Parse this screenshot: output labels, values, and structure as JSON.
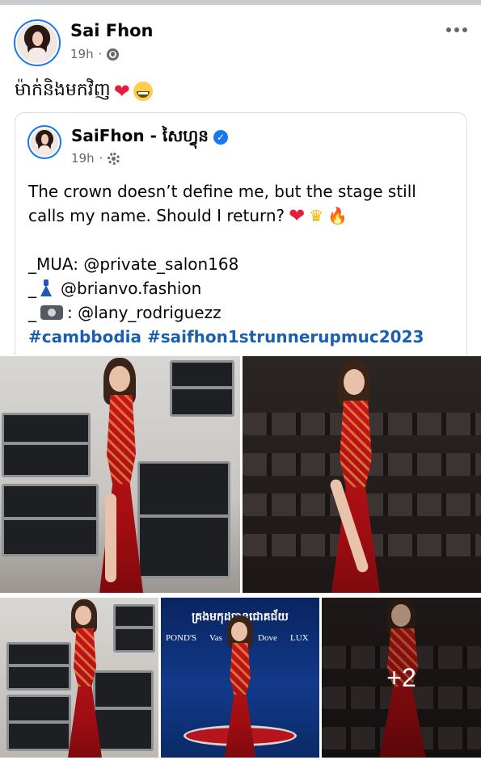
{
  "post": {
    "author": "Sai Fhon",
    "time": "19h",
    "separator": "·",
    "caption_text": "ម៉ាក់និងមកវិញ",
    "more_glyph": "•••"
  },
  "shared_post": {
    "author": "SaiFhon - សៃហ្វុន",
    "verified_glyph": "✓",
    "time": "19h",
    "separator": "·",
    "line1": "The crown doesn’t define me, but the stage still",
    "line2": "calls my name. Should I return?",
    "credit_mua": "_MUA: @private_salon168",
    "credit_fashion_prefix": "_",
    "credit_fashion": "@brianvo.fashion",
    "credit_photo_prefix": "_",
    "credit_photo": ": @lany_rodriguezz",
    "hashtags": "#cambbodia #saifhon1strunnerupmuc2023"
  },
  "emoji": {
    "heart": "❤",
    "crown": "♛",
    "fire": "🔥"
  },
  "photos": {
    "banner_text": "គ្រងមកុដបានជោគជ័យ",
    "brand_ponds": "POND'S",
    "brand_vaseline": "Vas",
    "brand_dove": "Dove",
    "brand_lux": "LUX",
    "more_count": "+2"
  },
  "icons": {
    "globe": "globe-icon",
    "gear": "gear-icon",
    "verified": "verified-badge-icon",
    "more": "more-options-icon"
  },
  "colors": {
    "link": "#1b5fb0",
    "verified": "#1877f2",
    "meta": "#65676b",
    "gown": "#c8151b"
  }
}
